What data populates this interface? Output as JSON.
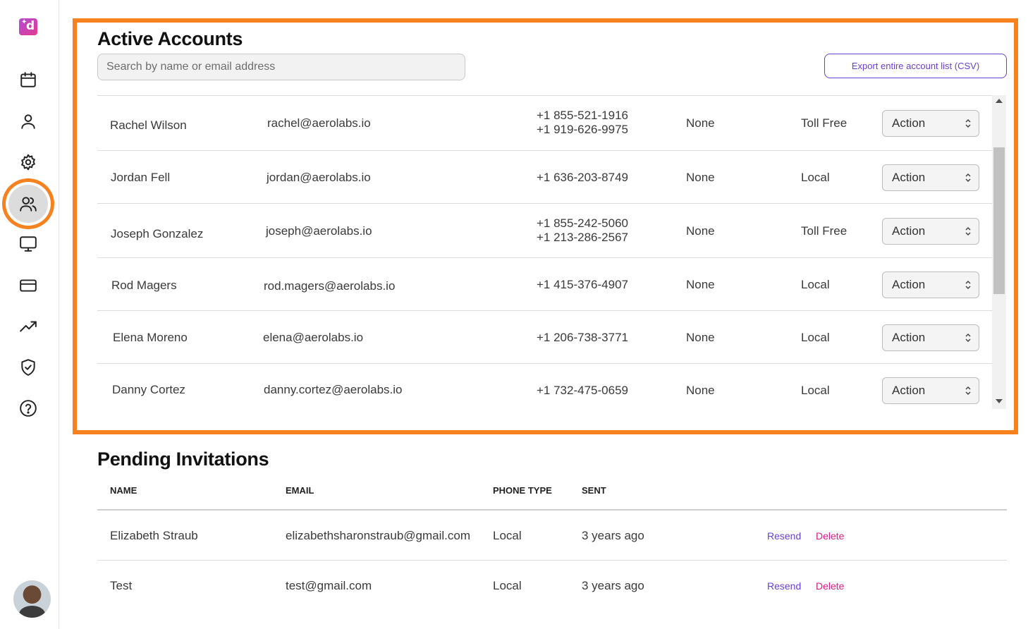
{
  "sidebar": {
    "logo_letter": "d",
    "nav": [
      {
        "name": "calendar-icon"
      },
      {
        "name": "user-icon"
      },
      {
        "name": "gear-icon"
      },
      {
        "name": "users-icon",
        "active": true
      },
      {
        "name": "monitor-icon"
      },
      {
        "name": "credit-card-icon"
      },
      {
        "name": "trending-up-icon"
      },
      {
        "name": "shield-check-icon"
      },
      {
        "name": "help-circle-icon"
      }
    ]
  },
  "active_accounts": {
    "title": "Active Accounts",
    "search_placeholder": "Search by name or email address",
    "export_label": "Export entire account list (CSV)",
    "rows": [
      {
        "name": "Rachel Wilson",
        "email": "rachel@aerolabs.io",
        "phone1": "+1 855-521-1916",
        "phone2": "+1 919-626-9975",
        "forward": "None",
        "type": "Toll Free",
        "action": "Action"
      },
      {
        "name": "Jordan Fell",
        "email": "jordan@aerolabs.io",
        "phone1": "+1 636-203-8749",
        "phone2": "",
        "forward": "None",
        "type": "Local",
        "action": "Action"
      },
      {
        "name": "Joseph Gonzalez",
        "email": "joseph@aerolabs.io",
        "phone1": "+1 855-242-5060",
        "phone2": "+1 213-286-2567",
        "forward": "None",
        "type": "Toll Free",
        "action": "Action"
      },
      {
        "name": "Rod Magers",
        "email": "rod.magers@aerolabs.io",
        "phone1": "+1 415-376-4907",
        "phone2": "",
        "forward": "None",
        "type": "Local",
        "action": "Action"
      },
      {
        "name": "Elena Moreno",
        "email": "elena@aerolabs.io",
        "phone1": "+1 206-738-3771",
        "phone2": "",
        "forward": "None",
        "type": "Local",
        "action": "Action"
      },
      {
        "name": "Danny Cortez",
        "email": "danny.cortez@aerolabs.io",
        "phone1": "+1 732-475-0659",
        "phone2": "",
        "forward": "None",
        "type": "Local",
        "action": "Action"
      }
    ]
  },
  "pending_invitations": {
    "title": "Pending Invitations",
    "columns": {
      "name": "NAME",
      "email": "EMAIL",
      "phone_type": "PHONE TYPE",
      "sent": "SENT"
    },
    "rows": [
      {
        "name": "Elizabeth Straub",
        "email": "elizabethsharonstraub@gmail.com",
        "phone_type": "Local",
        "sent": "3 years ago",
        "resend": "Resend",
        "delete": "Delete"
      },
      {
        "name": "Test",
        "email": "test@gmail.com",
        "phone_type": "Local",
        "sent": "3 years ago",
        "resend": "Resend",
        "delete": "Delete"
      }
    ]
  },
  "colors": {
    "highlight": "#f6821f",
    "accent": "#6a3fd8",
    "delete": "#e0198a"
  }
}
